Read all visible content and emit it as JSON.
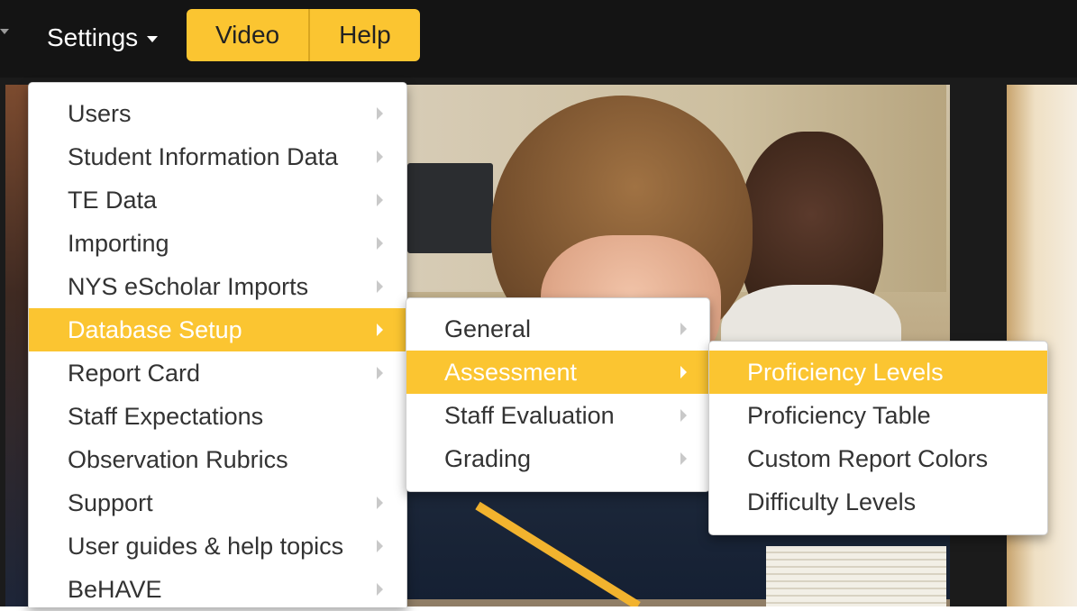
{
  "nav": {
    "settings_label": "Settings",
    "video_label": "Video",
    "help_label": "Help"
  },
  "colors": {
    "accent": "#fbc531",
    "navbar": "#141414",
    "menu_text": "#333333"
  },
  "menu": {
    "items": [
      {
        "label": "Users",
        "has_submenu": true
      },
      {
        "label": "Student Information Data",
        "has_submenu": true
      },
      {
        "label": "TE Data",
        "has_submenu": true
      },
      {
        "label": "Importing",
        "has_submenu": true
      },
      {
        "label": "NYS eScholar Imports",
        "has_submenu": true
      },
      {
        "label": "Database Setup",
        "has_submenu": true,
        "active": true
      },
      {
        "label": "Report Card",
        "has_submenu": true
      },
      {
        "label": "Staff Expectations",
        "has_submenu": false
      },
      {
        "label": "Observation Rubrics",
        "has_submenu": false
      },
      {
        "label": "Support",
        "has_submenu": true
      },
      {
        "label": "User guides & help topics",
        "has_submenu": true
      },
      {
        "label": "BeHAVE",
        "has_submenu": true
      }
    ]
  },
  "submenu_database_setup": {
    "items": [
      {
        "label": "General",
        "has_submenu": true
      },
      {
        "label": "Assessment",
        "has_submenu": true,
        "active": true
      },
      {
        "label": "Staff Evaluation",
        "has_submenu": true
      },
      {
        "label": "Grading",
        "has_submenu": true
      }
    ]
  },
  "submenu_assessment": {
    "items": [
      {
        "label": "Proficiency Levels",
        "active": true
      },
      {
        "label": "Proficiency Table"
      },
      {
        "label": "Custom Report Colors"
      },
      {
        "label": "Difficulty Levels"
      }
    ]
  }
}
